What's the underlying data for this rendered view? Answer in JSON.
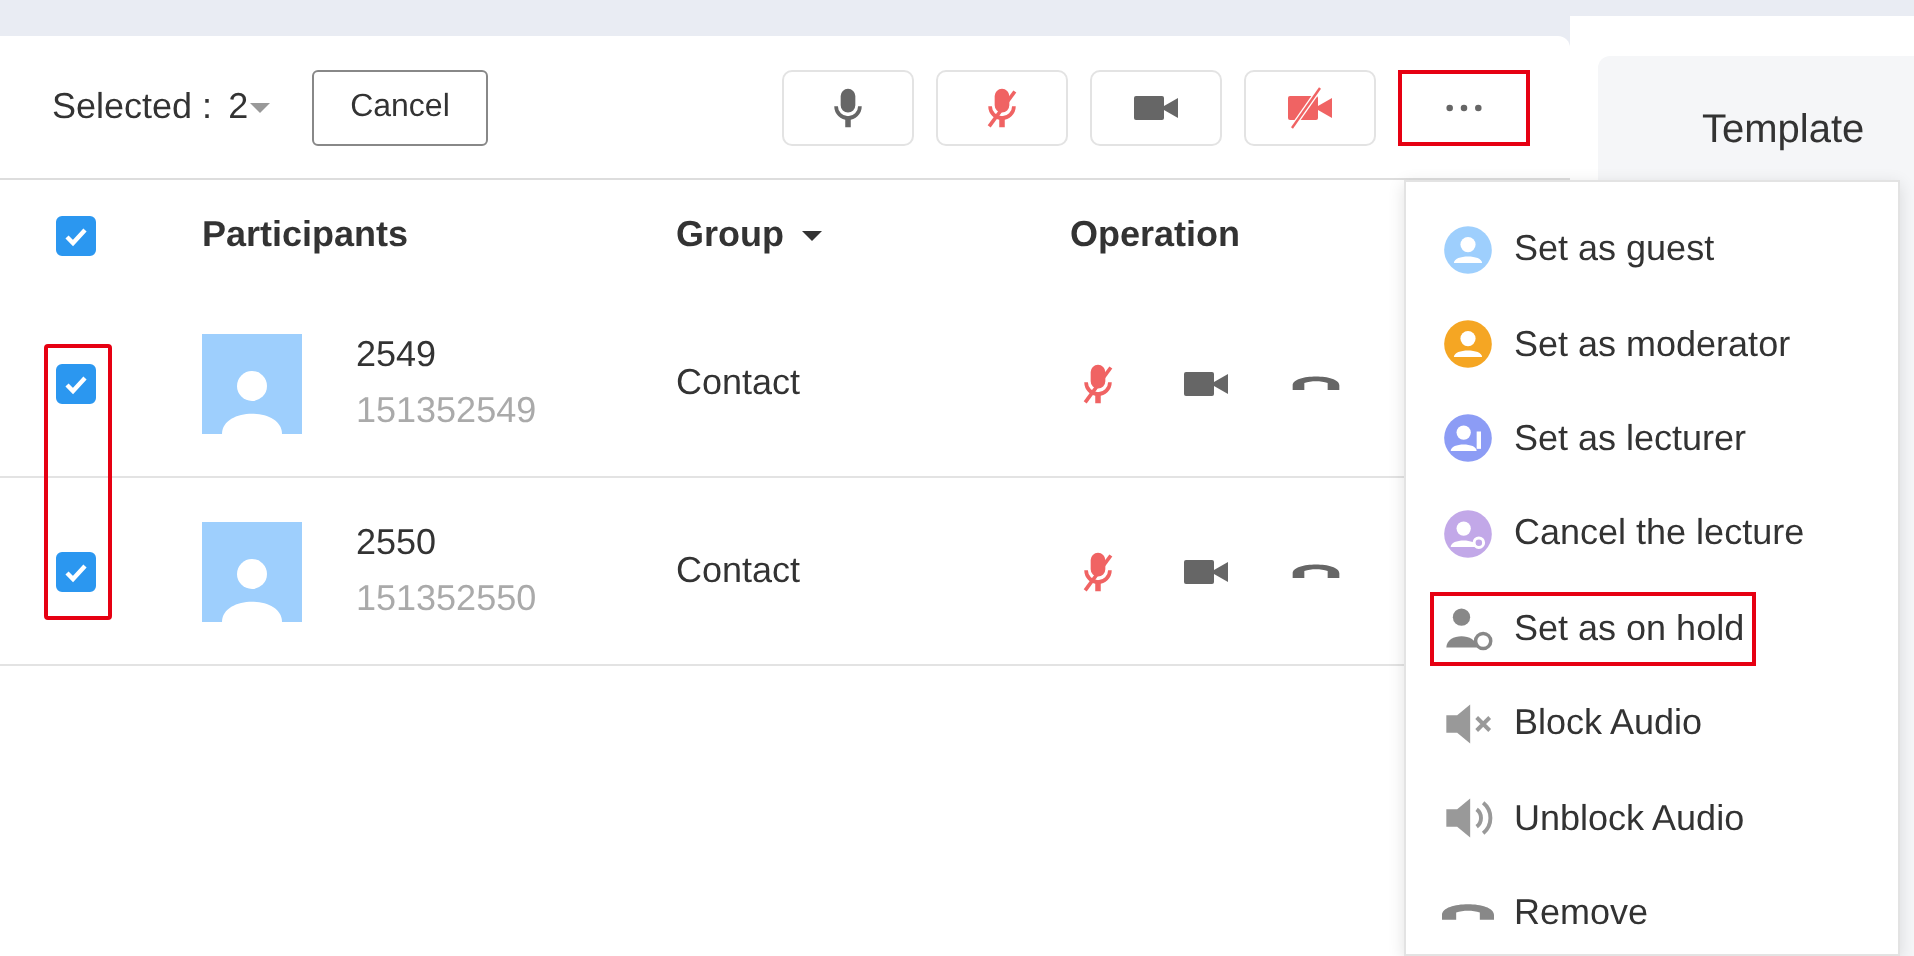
{
  "toolbar": {
    "selected_label": "Selected :",
    "selected_count": "2",
    "cancel_button": "Cancel",
    "buttons": [
      {
        "kind": "mic",
        "highlighted": false
      },
      {
        "kind": "mic-muted",
        "highlighted": false
      },
      {
        "kind": "camera",
        "highlighted": false
      },
      {
        "kind": "camera-off",
        "highlighted": false
      },
      {
        "kind": "more",
        "highlighted": true
      }
    ]
  },
  "table": {
    "all_checked": true,
    "checkbox_column_highlighted": true,
    "columns": [
      {
        "label": "Participants"
      },
      {
        "label": "Group",
        "sortable": true
      },
      {
        "label": "Operation"
      }
    ],
    "rows": [
      {
        "checked": true,
        "name": "2549",
        "number": "151352549",
        "group": "Contact",
        "muted": true
      },
      {
        "checked": true,
        "name": "2550",
        "number": "151352550",
        "group": "Contact",
        "muted": true
      }
    ]
  },
  "side_panel": {
    "title": "Template"
  },
  "menu": {
    "items": [
      {
        "kind": "guest",
        "label": "Set as guest",
        "highlighted": false
      },
      {
        "kind": "moderator",
        "label": "Set as moderator",
        "highlighted": false
      },
      {
        "kind": "lecturer",
        "label": "Set as lecturer",
        "highlighted": false
      },
      {
        "kind": "cancel-lecture",
        "label": "Cancel the lecture",
        "highlighted": false
      },
      {
        "kind": "on-hold",
        "label": "Set as on hold",
        "highlighted": true
      },
      {
        "kind": "block-audio",
        "label": "Block Audio",
        "highlighted": false
      },
      {
        "kind": "unblock-audio",
        "label": "Unblock Audio",
        "highlighted": false
      },
      {
        "kind": "remove",
        "label": "Remove",
        "highlighted": false
      }
    ]
  }
}
